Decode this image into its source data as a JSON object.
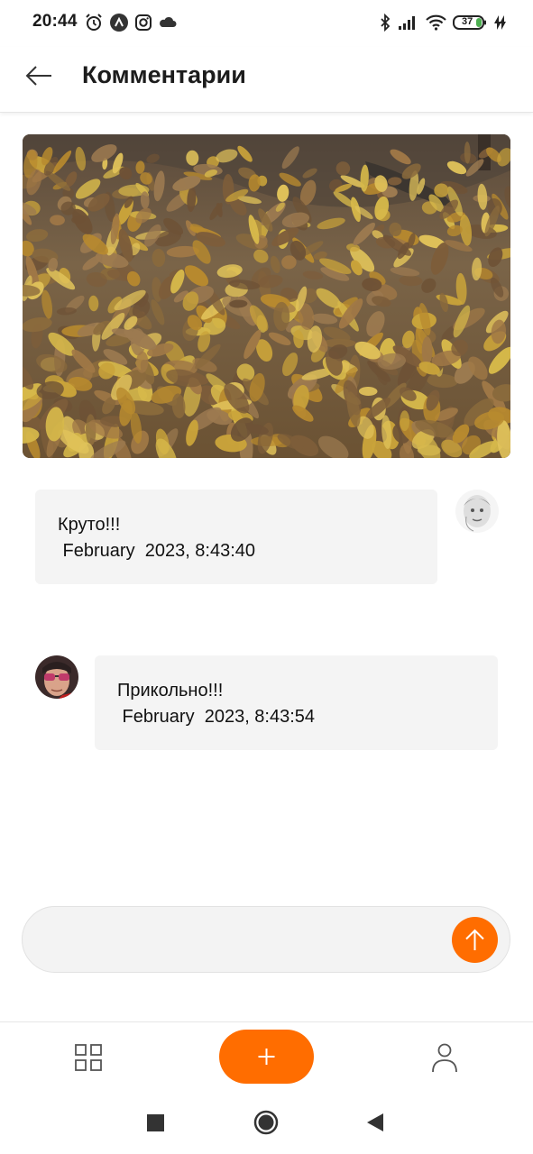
{
  "status_bar": {
    "time": "20:44",
    "battery_level": "37",
    "icons": [
      "alarm-icon",
      "app-logo-icon",
      "instagram-icon",
      "cloud-icon",
      "bluetooth-icon",
      "signal-icon",
      "wifi-icon",
      "battery-icon",
      "charging-icon"
    ]
  },
  "header": {
    "title": "Комментарии",
    "back_icon": "arrow-left-icon"
  },
  "post": {
    "photo": "autumn-leaves-photo"
  },
  "comments": [
    {
      "text": "Круто!!!",
      "date": " February  2023, 8:43:40",
      "side": "left-bubble-right-avatar"
    },
    {
      "text": "Прикольно!!!",
      "date": " February  2023, 8:43:54",
      "side": "right-bubble-left-avatar"
    }
  ],
  "input": {
    "value": "",
    "placeholder": "",
    "send_icon": "arrow-up-icon"
  },
  "bottom_nav": {
    "items": [
      "grid-icon",
      "plus-icon",
      "user-icon"
    ]
  },
  "system_nav": {
    "items": [
      "square-icon",
      "circle-icon",
      "triangle-back-icon"
    ]
  },
  "colors": {
    "accent": "#ff6d00",
    "bubble_bg": "#f4f4f4",
    "text": "#111111",
    "nav_icon": "#555555"
  }
}
